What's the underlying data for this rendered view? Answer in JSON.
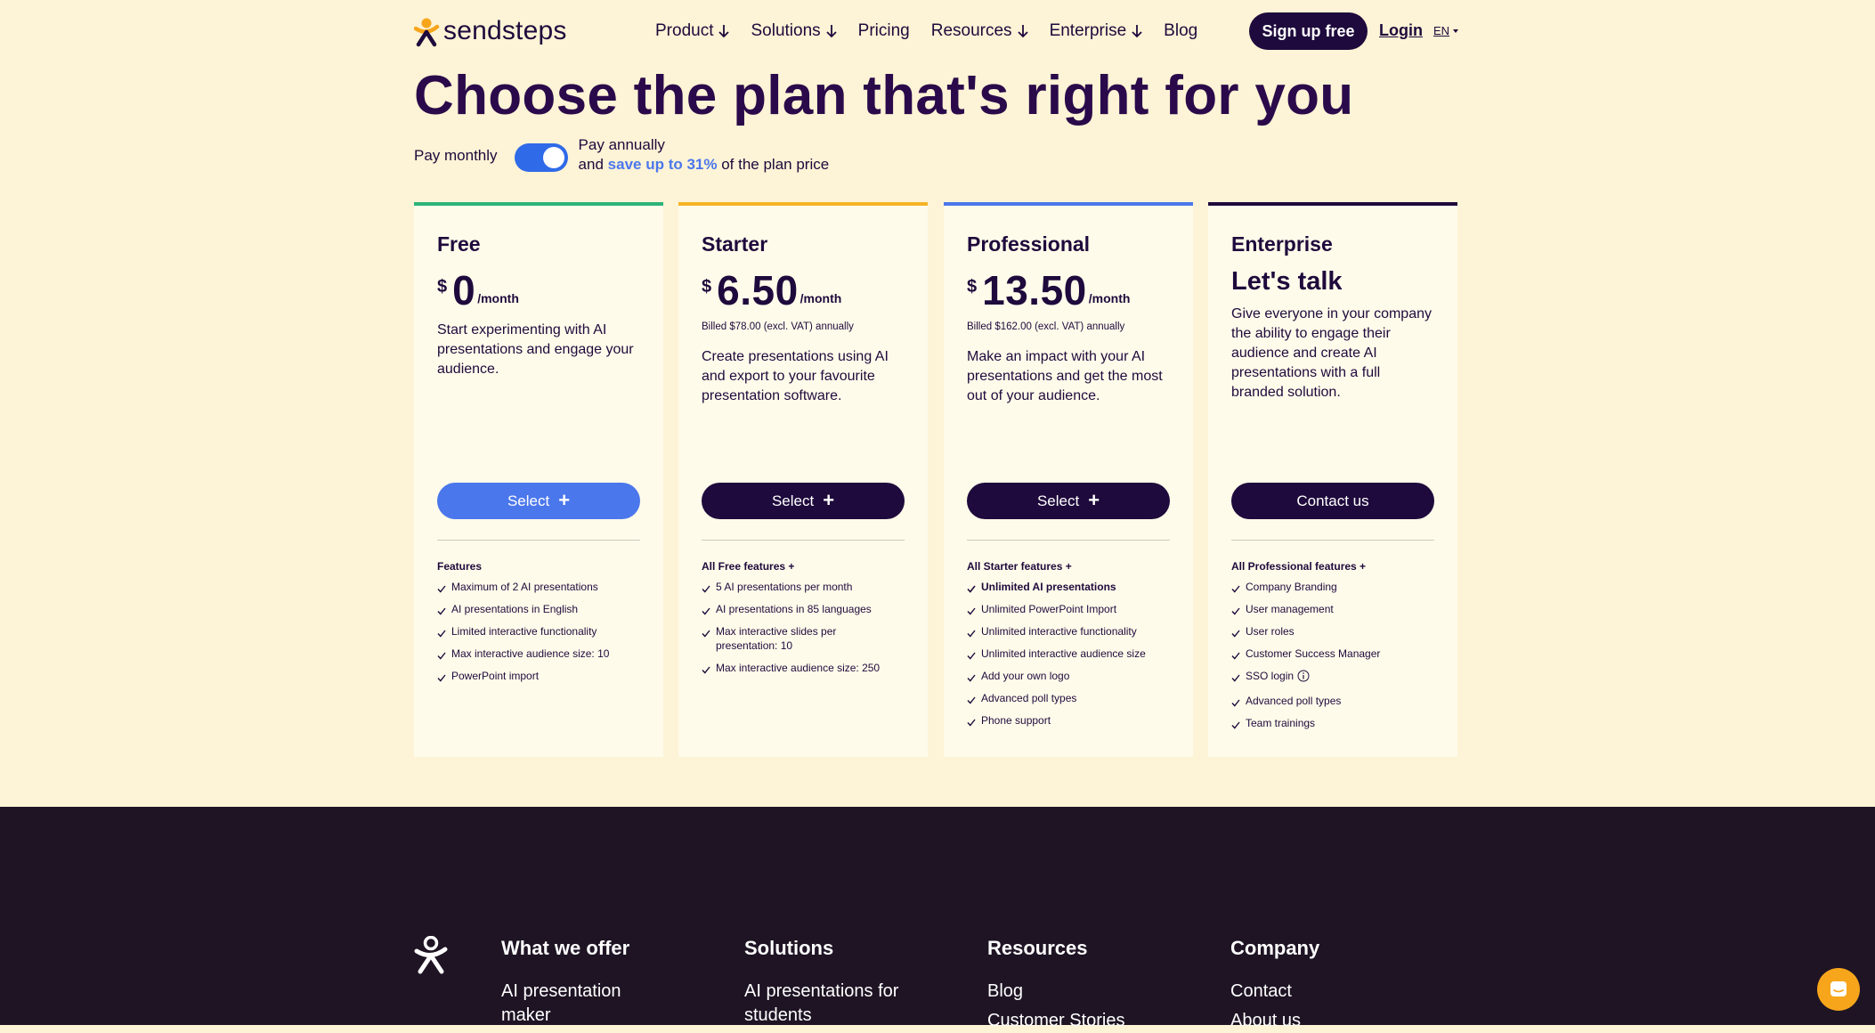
{
  "header": {
    "logo_text": "sendsteps",
    "nav": [
      {
        "label": "Product",
        "has_dropdown": true
      },
      {
        "label": "Solutions",
        "has_dropdown": true
      },
      {
        "label": "Pricing",
        "has_dropdown": false
      },
      {
        "label": "Resources",
        "has_dropdown": true
      },
      {
        "label": "Enterprise",
        "has_dropdown": true
      },
      {
        "label": "Blog",
        "has_dropdown": false
      }
    ],
    "signup_label": "Sign up free",
    "login_label": "Login",
    "language": "EN"
  },
  "page_title": "Choose the plan that's right for you",
  "billing": {
    "monthly_label": "Pay monthly",
    "annual_label": "Pay annually",
    "save_prefix": "and",
    "save_highlight": "save up to 31%",
    "save_suffix": "of the plan price",
    "annual_selected": true
  },
  "plans": [
    {
      "name": "Free",
      "currency": "$",
      "amount": "0",
      "period": "/month",
      "billed": "",
      "description": "Start experimenting with AI presentations and engage your audience.",
      "button": "Select",
      "features_title": "Features",
      "features": [
        {
          "text": "Maximum of 2 AI presentations"
        },
        {
          "text": "AI presentations in English"
        },
        {
          "text": "Limited interactive functionality"
        },
        {
          "text": "Max interactive audience size: 10"
        },
        {
          "text": "PowerPoint import"
        }
      ],
      "accent": "#2db37a"
    },
    {
      "name": "Starter",
      "currency": "$",
      "amount": "6.50",
      "period": "/month",
      "billed": "Billed $78.00 (excl. VAT) annually",
      "description": "Create presentations using AI and export to your favourite presentation software.",
      "button": "Select",
      "features_title": "All Free features +",
      "features": [
        {
          "text": "5 AI presentations per month"
        },
        {
          "text": "AI presentations in 85 languages"
        },
        {
          "text": "Max interactive slides per presentation: 10"
        },
        {
          "text": "Max interactive audience size: 250"
        }
      ],
      "accent": "#f5b324"
    },
    {
      "name": "Professional",
      "currency": "$",
      "amount": "13.50",
      "period": "/month",
      "billed": "Billed $162.00 (excl. VAT) annually",
      "description": "Make an impact with your AI presentations and get the most out of your audience.",
      "button": "Select",
      "features_title": "All Starter features +",
      "features": [
        {
          "text": "Unlimited AI presentations",
          "bold": true
        },
        {
          "text": "Unlimited PowerPoint Import"
        },
        {
          "text": "Unlimited interactive functionality"
        },
        {
          "text": "Unlimited interactive audience size"
        },
        {
          "text": "Add your own logo"
        },
        {
          "text": "Advanced poll types"
        },
        {
          "text": "Phone support"
        }
      ],
      "accent": "#4b77ec"
    },
    {
      "name": "Enterprise",
      "headline": "Let's talk",
      "description": "Give everyone in your company the ability to engage their audience and create AI presentations with a full branded solution.",
      "button": "Contact us",
      "features_title": "All Professional features +",
      "features": [
        {
          "text": "Company Branding"
        },
        {
          "text": "User management"
        },
        {
          "text": "User roles"
        },
        {
          "text": "Customer Success Manager"
        },
        {
          "text": "SSO login",
          "info": true
        },
        {
          "text": "Advanced poll types"
        },
        {
          "text": "Team trainings"
        }
      ],
      "accent": "#1e0a3c"
    }
  ],
  "footer": {
    "columns": [
      {
        "title": "What we offer",
        "links": [
          "AI presentation maker"
        ]
      },
      {
        "title": "Solutions",
        "links": [
          "AI presentations for students"
        ]
      },
      {
        "title": "Resources",
        "links": [
          "Blog",
          "Customer Stories"
        ]
      },
      {
        "title": "Company",
        "links": [
          "Contact",
          "About us"
        ]
      }
    ]
  },
  "colors": {
    "background": "#fdf3d6",
    "text_dark": "#1e0a3c",
    "accent_blue": "#4b77ec",
    "footer_bg": "#1e1424",
    "chat_bubble": "#f7a51b"
  }
}
